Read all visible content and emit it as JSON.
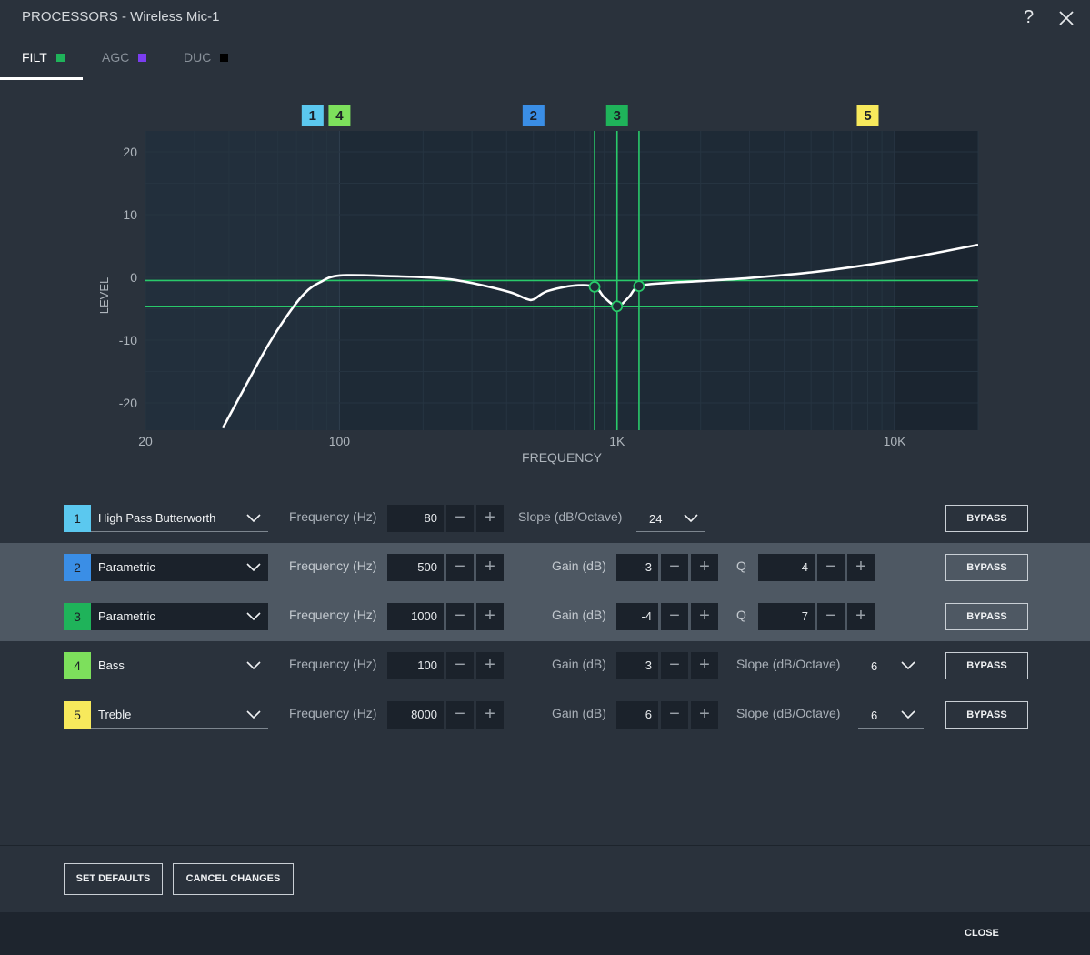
{
  "window": {
    "title": "PROCESSORS - Wireless Mic-1",
    "help_label": "?"
  },
  "tabs": [
    {
      "label": "FILT",
      "color": "#1fb35a",
      "active": true
    },
    {
      "label": "AGC",
      "color": "#7b3df0",
      "active": false
    },
    {
      "label": "DUC",
      "color": "#000000",
      "active": false
    }
  ],
  "chart_data": {
    "type": "line",
    "xlabel": "FREQUENCY",
    "ylabel": "LEVEL",
    "x_scale": "log",
    "xlim": [
      20,
      20000
    ],
    "ylim": [
      -24,
      24
    ],
    "x_ticks": [
      20,
      100,
      1000,
      10000
    ],
    "x_tick_labels": [
      "20",
      "100",
      "1K",
      "10K"
    ],
    "y_ticks": [
      20,
      10,
      0,
      -10,
      -20
    ],
    "y_tick_labels": [
      "20",
      "10",
      "0",
      "-10",
      "-20"
    ],
    "grid": true,
    "curve": {
      "x": [
        38,
        45,
        55,
        65,
        75,
        85,
        100,
        150,
        250,
        400,
        470,
        500,
        560,
        700,
        830,
        900,
        1000,
        1100,
        1200,
        1500,
        2000,
        3000,
        5000,
        8000,
        12000,
        20000
      ],
      "y": [
        -24,
        -18,
        -11,
        -6,
        -2.5,
        -0.8,
        0.3,
        0.2,
        -0.3,
        -2.2,
        -3.4,
        -3.5,
        -2.2,
        -1.3,
        -1.5,
        -3.2,
        -4.6,
        -3.2,
        -1.4,
        -0.9,
        -0.6,
        -0.1,
        0.8,
        2.0,
        3.3,
        5.2
      ]
    },
    "markers": [
      {
        "label": "1",
        "freq": 80,
        "color": "#5bc8ef"
      },
      {
        "label": "4",
        "freq": 100,
        "color": "#7de05c"
      },
      {
        "label": "2",
        "freq": 500,
        "color": "#3a8ee6"
      },
      {
        "label": "3",
        "freq": 1000,
        "color": "#1fb35a"
      },
      {
        "label": "5",
        "freq": 8000,
        "color": "#f7e95c"
      }
    ],
    "selection": {
      "center_freq": 1000,
      "left_freq": 830,
      "right_freq": 1200,
      "top_level": -0.5,
      "bottom_level": -4.6,
      "color": "#29c96a"
    },
    "handles": [
      {
        "freq": 830,
        "level": -1.5
      },
      {
        "freq": 1000,
        "level": -4.6
      },
      {
        "freq": 1200,
        "level": -1.4
      }
    ]
  },
  "filters": [
    {
      "num": "1",
      "color": "#5bc8ef",
      "type": "High Pass Butterworth",
      "freq_label": "Frequency (Hz)",
      "freq": "80",
      "slope_label": "Slope (dB/Octave)",
      "slope": "24",
      "bypass": "BYPASS"
    },
    {
      "num": "2",
      "color": "#3a8ee6",
      "type": "Parametric",
      "freq_label": "Frequency (Hz)",
      "freq": "500",
      "gain_label": "Gain (dB)",
      "gain": "-3",
      "q_label": "Q",
      "q": "4",
      "bypass": "BYPASS"
    },
    {
      "num": "3",
      "color": "#1fb35a",
      "type": "Parametric",
      "freq_label": "Frequency (Hz)",
      "freq": "1000",
      "gain_label": "Gain (dB)",
      "gain": "-4",
      "q_label": "Q",
      "q": "7",
      "bypass": "BYPASS"
    },
    {
      "num": "4",
      "color": "#7de05c",
      "type": "Bass",
      "freq_label": "Frequency (Hz)",
      "freq": "100",
      "gain_label": "Gain (dB)",
      "gain": "3",
      "slope_label": "Slope (dB/Octave)",
      "slope": "6",
      "bypass": "BYPASS"
    },
    {
      "num": "5",
      "color": "#f7e95c",
      "type": "Treble",
      "freq_label": "Frequency (Hz)",
      "freq": "8000",
      "gain_label": "Gain (dB)",
      "gain": "6",
      "slope_label": "Slope (dB/Octave)",
      "slope": "6",
      "bypass": "BYPASS"
    }
  ],
  "stepper": {
    "minus": "−",
    "plus": "+"
  },
  "buttons": {
    "set_defaults": "SET DEFAULTS",
    "cancel_changes": "CANCEL CHANGES",
    "close": "CLOSE"
  }
}
